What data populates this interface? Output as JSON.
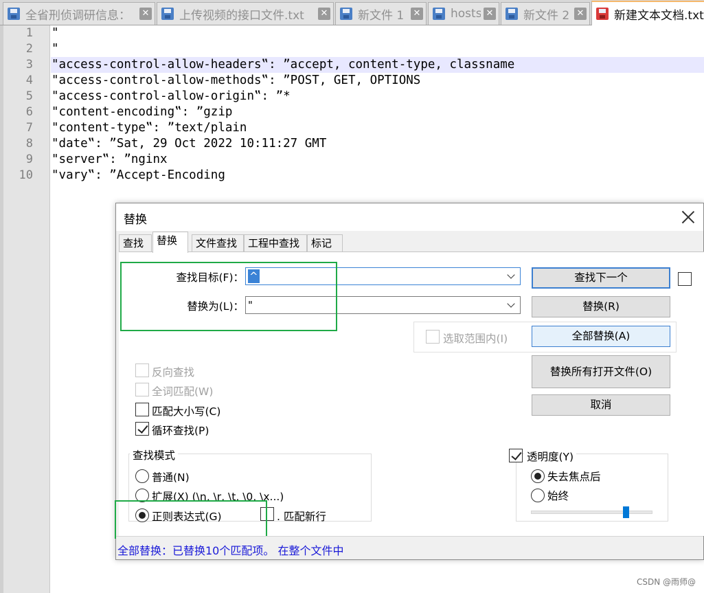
{
  "tabs": [
    {
      "label": "全省刑侦调研信息：",
      "active": false
    },
    {
      "label": "上传视频的接口文件.txt",
      "active": false
    },
    {
      "label": "新文件 1",
      "active": false
    },
    {
      "label": "hosts",
      "active": false
    },
    {
      "label": "新文件 2",
      "active": false
    },
    {
      "label": "新建文本文档.txt",
      "active": true
    }
  ],
  "editor": {
    "line_numbers": [
      "1",
      "2",
      "3",
      "4",
      "5",
      "6",
      "7",
      "8",
      "9",
      "10"
    ],
    "lines": [
      "\"",
      "\"",
      "\"access-control-allow-headers‟: ”accept, content-type, classname",
      "\"access-control-allow-methods‟: ”POST, GET, OPTIONS",
      "\"access-control-allow-origin‟: ”*",
      "\"content-encoding‟: ”gzip",
      "\"content-type‟: ”text/plain",
      "\"date‟: ”Sat, 29 Oct 2022 10:11:27 GMT",
      "\"server‟: ”nginx",
      "\"vary‟: ”Accept-Encoding"
    ],
    "current_line": 3
  },
  "dialog": {
    "title": "替换",
    "tabs": [
      "查找",
      "替换",
      "文件查找",
      "工程中查找",
      "标记"
    ],
    "active_tab": "替换",
    "find_label": "查找目标(F)：",
    "find_value": "^",
    "replace_label": "替换为(L)：",
    "replace_value": "\"",
    "in_selection_label": "选取范围内(I)",
    "buttons": {
      "find_next": "查找下一个",
      "replace": "替换(R)",
      "replace_all": "全部替换(A)",
      "replace_all_open": "替换所有打开文件(O)",
      "cancel": "取消"
    },
    "options": {
      "backward": {
        "label": "反向查找",
        "checked": false,
        "disabled": true
      },
      "whole_word": {
        "label": "全词匹配(W)",
        "checked": false,
        "disabled": true
      },
      "match_case": {
        "label": "匹配大小写(C)",
        "checked": false,
        "disabled": false
      },
      "wrap": {
        "label": "循环查找(P)",
        "checked": true,
        "disabled": false
      }
    },
    "search_mode": {
      "title": "查找模式",
      "normal": "普通(N)",
      "extended": "扩展(X) (\\n, \\r, \\t, \\0, \\x...)",
      "regex": "正则表达式(G)",
      "dot_newline": ". 匹配新行",
      "selected": "regex"
    },
    "transparency": {
      "label": "透明度(Y)",
      "checked": true,
      "on_lose_focus": "失去焦点后",
      "always": "始终",
      "selected": "on_lose_focus",
      "level": 0.8
    },
    "status": "全部替换：已替换10个匹配项。 在整个文件中"
  },
  "watermark": "CSDN @雨师@",
  "colors": {
    "highlight_box": "#1faa47",
    "status_text": "#1a1ad8",
    "current_line": "#e8e8ff"
  }
}
